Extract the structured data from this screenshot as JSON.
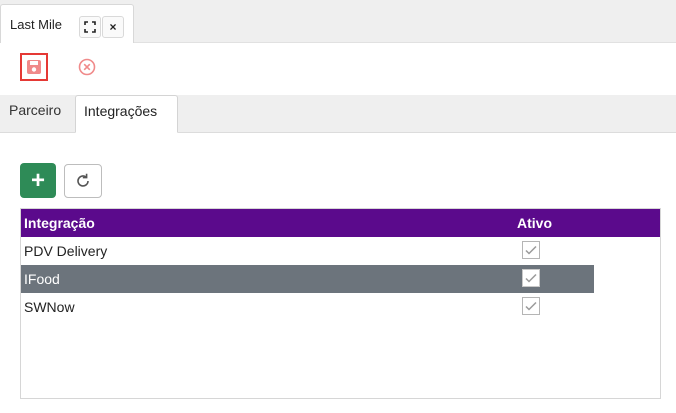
{
  "window": {
    "tab_title": "Last Mile",
    "expand_icon": "⛶",
    "close_icon": "×"
  },
  "toolbar": {
    "save_icon": "save-icon",
    "cancel_icon": "cancel-circle-icon",
    "accent_red": "#e53935",
    "cancel_color": "#f08a8a"
  },
  "subtabs": [
    {
      "label": "Parceiro",
      "active": false
    },
    {
      "label": "Integrações",
      "active": true
    }
  ],
  "actions": {
    "add_label": "+",
    "add_color": "#2e8b57",
    "refresh_icon": "refresh-icon"
  },
  "grid": {
    "header_color": "#5b0a8c",
    "columns": [
      "Integração",
      "Ativo"
    ],
    "rows": [
      {
        "name": "PDV Delivery",
        "ativo": true,
        "selected": false
      },
      {
        "name": "IFood",
        "ativo": true,
        "selected": true
      },
      {
        "name": "SWNow",
        "ativo": true,
        "selected": false
      }
    ]
  }
}
